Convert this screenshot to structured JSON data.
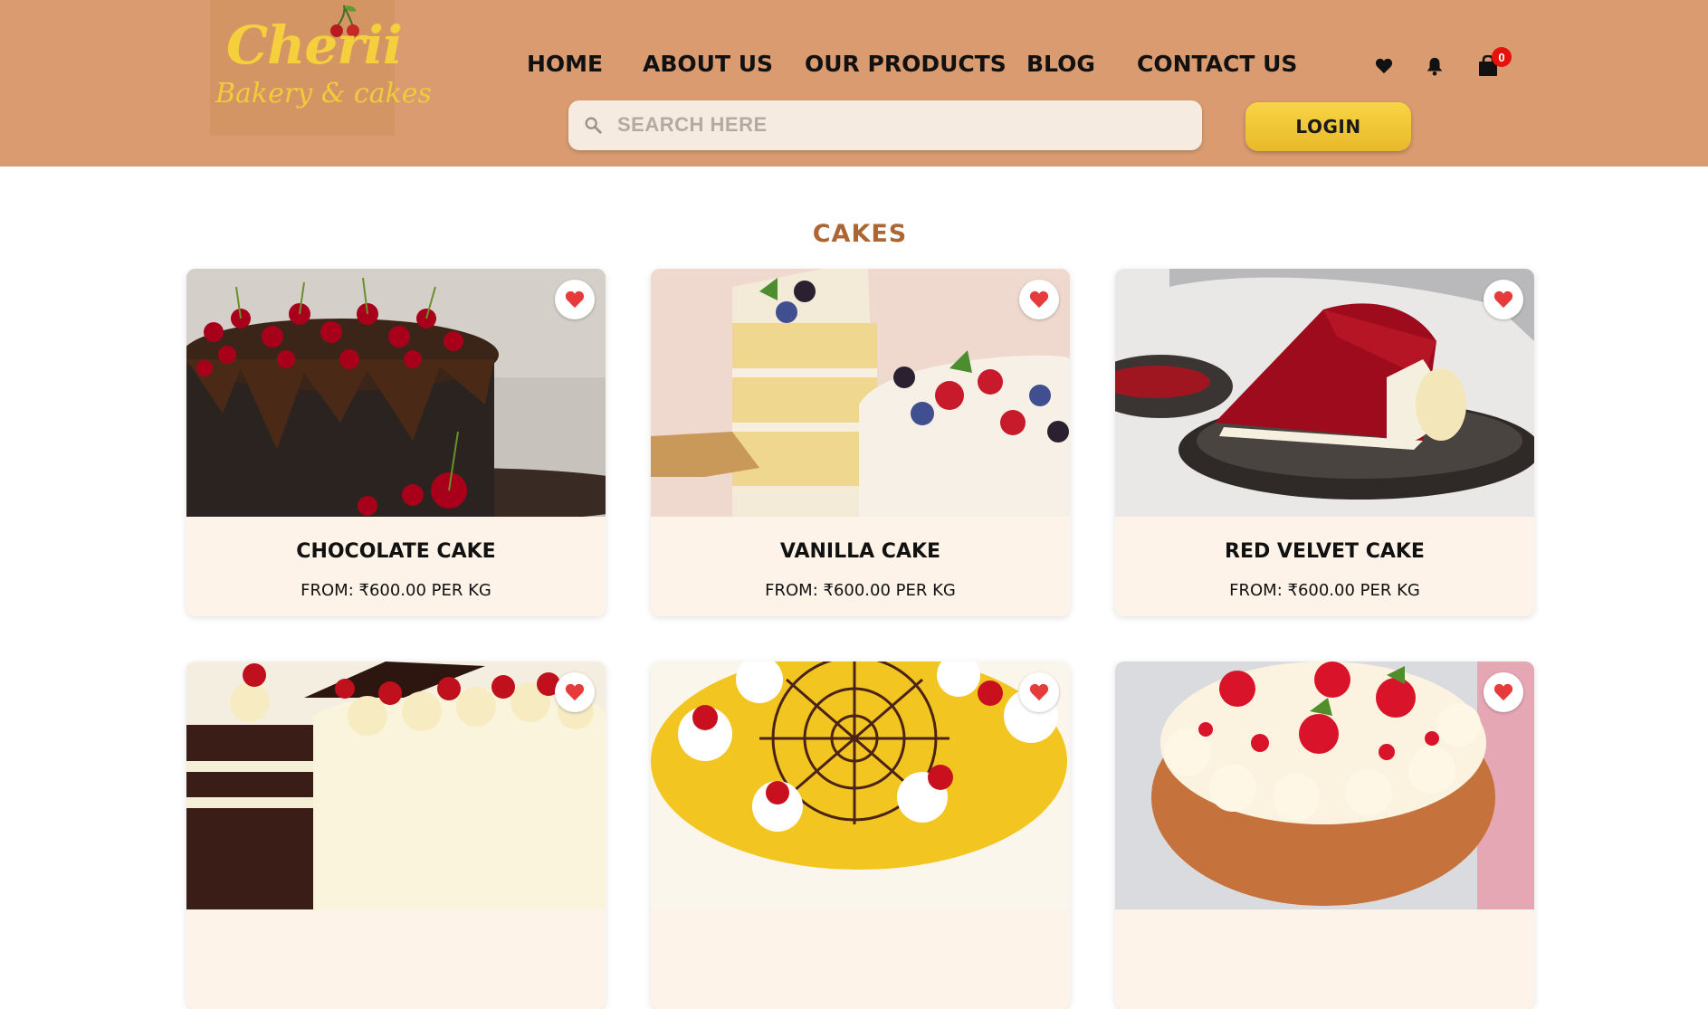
{
  "brand": {
    "name": "Cherii",
    "tagline": "Bakery & cakes"
  },
  "nav": {
    "home": "HOME",
    "about": "ABOUT US",
    "products": "OUR PRODUCTS",
    "blog": "BLOG",
    "contact": "CONTACT US"
  },
  "header_icons": {
    "wishlist": "heart-icon",
    "notifications": "bell-icon",
    "cart": "shopping-bag-icon",
    "cart_count": "0"
  },
  "search": {
    "placeholder": "SEARCH HERE",
    "value": ""
  },
  "login_label": "LOGIN",
  "section_title": "CAKES",
  "products": [
    {
      "name": "CHOCOLATE CAKE",
      "price": "FROM: ₹600.00 PER KG"
    },
    {
      "name": "VANILLA CAKE",
      "price": "FROM: ₹600.00 PER KG"
    },
    {
      "name": "RED VELVET CAKE",
      "price": "FROM: ₹600.00 PER KG"
    },
    {
      "name": "",
      "price": ""
    },
    {
      "name": "",
      "price": ""
    },
    {
      "name": "",
      "price": ""
    }
  ],
  "colors": {
    "header_bg": "#d99b6f",
    "logo_yellow": "#f5cf3c",
    "section_title": "#ad6633",
    "card_info_bg": "#fdf3e8",
    "login_bg": "#f4c93a",
    "favorite_red": "#e53b3b",
    "badge_red": "#e8120c"
  }
}
